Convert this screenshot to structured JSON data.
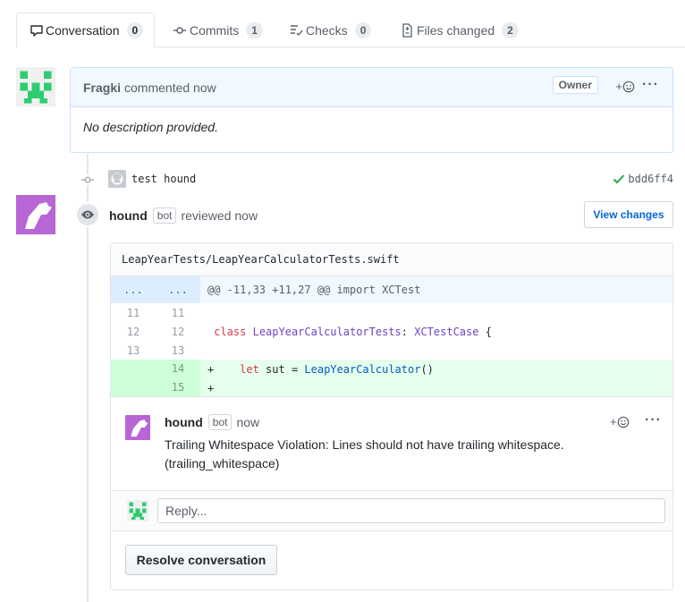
{
  "tabs": [
    {
      "label": "Conversation",
      "count": "0",
      "icon": "comment-icon",
      "selected": true
    },
    {
      "label": "Commits",
      "count": "1",
      "icon": "commit-icon"
    },
    {
      "label": "Checks",
      "count": "0",
      "icon": "checklist-icon"
    },
    {
      "label": "Files changed",
      "count": "2",
      "icon": "file-diff-icon"
    }
  ],
  "comment": {
    "author": "Fragki",
    "action": "commented now",
    "badge": "Owner",
    "body": "No description provided.",
    "react_label": "+",
    "more_label": "···"
  },
  "commit": {
    "message": "test hound",
    "sha": "bdd6ff4",
    "status_icon": "check-icon",
    "status_color": "#28a745"
  },
  "review": {
    "author": "hound",
    "bot_label": "bot",
    "action": "reviewed now",
    "view_changes_label": "View changes",
    "file_path": "LeapYearTests/LeapYearCalculatorTests.swift",
    "hunk": {
      "n1": "...",
      "n2": "...",
      "text": "@@ -11,33 +11,27 @@ import XCTest"
    },
    "lines": [
      {
        "n1": "11",
        "n2": "11",
        "sign": " ",
        "code": ""
      },
      {
        "n1": "12",
        "n2": "12",
        "sign": " ",
        "kw": "class",
        "name": "LeapYearCalculatorTests",
        "sep": ": ",
        "base": "XCTestCase",
        "rest": " {"
      },
      {
        "n1": "13",
        "n2": "13",
        "sign": " ",
        "code": ""
      },
      {
        "n1": "",
        "n2": "14",
        "sign": "+",
        "kw": "let",
        "mid": " sut = ",
        "call": "LeapYearCalculator",
        "rest": "()"
      },
      {
        "n1": "",
        "n2": "15",
        "sign": "+",
        "code": ""
      }
    ],
    "inline_comment": {
      "author": "hound",
      "bot_label": "bot",
      "time": "now",
      "body": "Trailing Whitespace Violation: Lines should not have trailing whitespace. (trailing_whitespace)",
      "react_label": "+",
      "more_label": "···"
    },
    "reply_placeholder": "Reply...",
    "resolve_label": "Resolve conversation"
  },
  "colors": {
    "accent_blue": "#0366d6",
    "fragki_avatar": "#2ecc71",
    "hound_avatar": "#b865d6"
  }
}
